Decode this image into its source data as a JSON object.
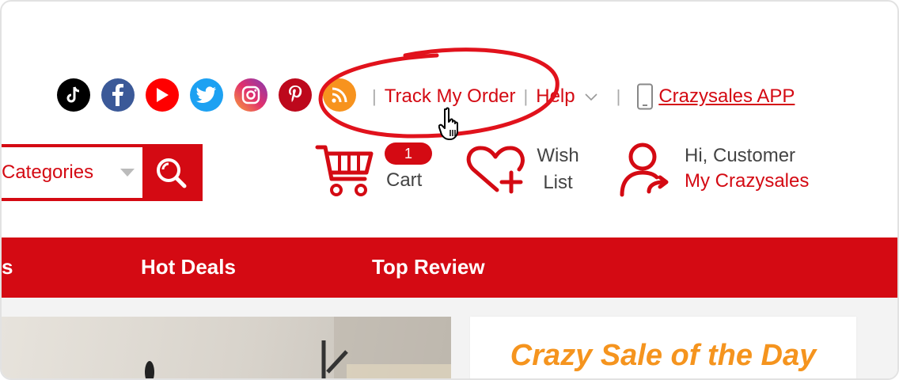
{
  "social": [
    {
      "name": "tiktok",
      "bg": "#000000"
    },
    {
      "name": "facebook",
      "bg": "#3b5998"
    },
    {
      "name": "youtube",
      "bg": "#ff0000"
    },
    {
      "name": "twitter",
      "bg": "#1da1f2"
    },
    {
      "name": "instagram",
      "bg": "#c13584"
    },
    {
      "name": "pinterest",
      "bg": "#bd081c"
    },
    {
      "name": "rss",
      "bg": "#f7931e"
    }
  ],
  "topbar": {
    "separator": "|",
    "track_order": "Track My Order",
    "help": "Help",
    "app_link": "Crazysales APP"
  },
  "search": {
    "category": "Categories"
  },
  "cart": {
    "count": "1",
    "label": "Cart"
  },
  "wishlist": {
    "line1": "Wish",
    "line2": "List"
  },
  "account": {
    "greeting": "Hi, Customer",
    "link": "My Crazysales"
  },
  "nav": {
    "items": [
      "s",
      "Hot Deals",
      "Top Review"
    ]
  },
  "promo": {
    "title": "Crazy Sale of the Day"
  },
  "colors": {
    "brand_red": "#d40a13",
    "promo_orange": "#f5941e"
  }
}
